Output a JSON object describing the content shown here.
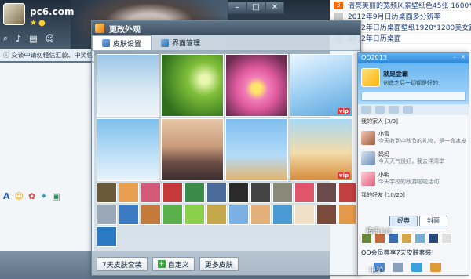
{
  "background": {
    "brand": "pc6.com",
    "toolbar_icons": [
      "search-icon",
      "mic-icon",
      "folder-icon",
      "user-icon"
    ],
    "notice": "交谈中请勿轻信汇款、中奖信"
  },
  "wallpaper_list": {
    "items": [
      {
        "num": "3",
        "text": "清亮美丽的宽频风景壁纸色45张 1600*"
      },
      {
        "num": "",
        "text": "2012年9月日历桌面多分辨率"
      },
      {
        "num": "",
        "text": "2012年日历桌面壁纸1920*1280美女篇"
      },
      {
        "num": "",
        "text": "2012年日历桌面"
      }
    ]
  },
  "dialog": {
    "title": "更改外观",
    "tabs": [
      {
        "label": "皮肤设置",
        "active": true
      },
      {
        "label": "界面管理",
        "active": false
      }
    ],
    "vip_label": "vip",
    "buttons": {
      "package": "7天皮肤套装",
      "custom": "自定义",
      "more": "更多皮肤"
    }
  },
  "preview": {
    "title": "QQ2013",
    "name": "就是金霸",
    "status": "创造之后一切都是好的",
    "group1": "我的家人 [3/3]",
    "contacts": [
      {
        "name": "小雪",
        "sub": "今天收到中秋节的礼物，是一盒冰皮月饼"
      },
      {
        "name": "妈妈",
        "sub": "今天天气很好，我去洋湾举"
      },
      {
        "name": "小明",
        "sub": "今天学校的秋游啦啦活动"
      }
    ],
    "group2": "我的好友 [10/20]",
    "skin_tabs": [
      "经典",
      "封面"
    ],
    "promo": "QQ会员尊享7天皮肤套装!"
  },
  "desktop": {
    "label1": "腾讯QQ",
    "label2": "电驴"
  }
}
